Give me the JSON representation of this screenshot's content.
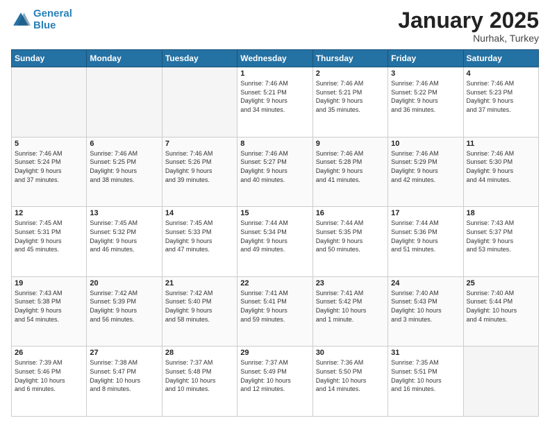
{
  "header": {
    "logo_line1": "General",
    "logo_line2": "Blue",
    "month": "January 2025",
    "location": "Nurhak, Turkey"
  },
  "weekdays": [
    "Sunday",
    "Monday",
    "Tuesday",
    "Wednesday",
    "Thursday",
    "Friday",
    "Saturday"
  ],
  "weeks": [
    [
      {
        "day": "",
        "info": ""
      },
      {
        "day": "",
        "info": ""
      },
      {
        "day": "",
        "info": ""
      },
      {
        "day": "1",
        "info": "Sunrise: 7:46 AM\nSunset: 5:21 PM\nDaylight: 9 hours\nand 34 minutes."
      },
      {
        "day": "2",
        "info": "Sunrise: 7:46 AM\nSunset: 5:21 PM\nDaylight: 9 hours\nand 35 minutes."
      },
      {
        "day": "3",
        "info": "Sunrise: 7:46 AM\nSunset: 5:22 PM\nDaylight: 9 hours\nand 36 minutes."
      },
      {
        "day": "4",
        "info": "Sunrise: 7:46 AM\nSunset: 5:23 PM\nDaylight: 9 hours\nand 37 minutes."
      }
    ],
    [
      {
        "day": "5",
        "info": "Sunrise: 7:46 AM\nSunset: 5:24 PM\nDaylight: 9 hours\nand 37 minutes."
      },
      {
        "day": "6",
        "info": "Sunrise: 7:46 AM\nSunset: 5:25 PM\nDaylight: 9 hours\nand 38 minutes."
      },
      {
        "day": "7",
        "info": "Sunrise: 7:46 AM\nSunset: 5:26 PM\nDaylight: 9 hours\nand 39 minutes."
      },
      {
        "day": "8",
        "info": "Sunrise: 7:46 AM\nSunset: 5:27 PM\nDaylight: 9 hours\nand 40 minutes."
      },
      {
        "day": "9",
        "info": "Sunrise: 7:46 AM\nSunset: 5:28 PM\nDaylight: 9 hours\nand 41 minutes."
      },
      {
        "day": "10",
        "info": "Sunrise: 7:46 AM\nSunset: 5:29 PM\nDaylight: 9 hours\nand 42 minutes."
      },
      {
        "day": "11",
        "info": "Sunrise: 7:46 AM\nSunset: 5:30 PM\nDaylight: 9 hours\nand 44 minutes."
      }
    ],
    [
      {
        "day": "12",
        "info": "Sunrise: 7:45 AM\nSunset: 5:31 PM\nDaylight: 9 hours\nand 45 minutes."
      },
      {
        "day": "13",
        "info": "Sunrise: 7:45 AM\nSunset: 5:32 PM\nDaylight: 9 hours\nand 46 minutes."
      },
      {
        "day": "14",
        "info": "Sunrise: 7:45 AM\nSunset: 5:33 PM\nDaylight: 9 hours\nand 47 minutes."
      },
      {
        "day": "15",
        "info": "Sunrise: 7:44 AM\nSunset: 5:34 PM\nDaylight: 9 hours\nand 49 minutes."
      },
      {
        "day": "16",
        "info": "Sunrise: 7:44 AM\nSunset: 5:35 PM\nDaylight: 9 hours\nand 50 minutes."
      },
      {
        "day": "17",
        "info": "Sunrise: 7:44 AM\nSunset: 5:36 PM\nDaylight: 9 hours\nand 51 minutes."
      },
      {
        "day": "18",
        "info": "Sunrise: 7:43 AM\nSunset: 5:37 PM\nDaylight: 9 hours\nand 53 minutes."
      }
    ],
    [
      {
        "day": "19",
        "info": "Sunrise: 7:43 AM\nSunset: 5:38 PM\nDaylight: 9 hours\nand 54 minutes."
      },
      {
        "day": "20",
        "info": "Sunrise: 7:42 AM\nSunset: 5:39 PM\nDaylight: 9 hours\nand 56 minutes."
      },
      {
        "day": "21",
        "info": "Sunrise: 7:42 AM\nSunset: 5:40 PM\nDaylight: 9 hours\nand 58 minutes."
      },
      {
        "day": "22",
        "info": "Sunrise: 7:41 AM\nSunset: 5:41 PM\nDaylight: 9 hours\nand 59 minutes."
      },
      {
        "day": "23",
        "info": "Sunrise: 7:41 AM\nSunset: 5:42 PM\nDaylight: 10 hours\nand 1 minute."
      },
      {
        "day": "24",
        "info": "Sunrise: 7:40 AM\nSunset: 5:43 PM\nDaylight: 10 hours\nand 3 minutes."
      },
      {
        "day": "25",
        "info": "Sunrise: 7:40 AM\nSunset: 5:44 PM\nDaylight: 10 hours\nand 4 minutes."
      }
    ],
    [
      {
        "day": "26",
        "info": "Sunrise: 7:39 AM\nSunset: 5:46 PM\nDaylight: 10 hours\nand 6 minutes."
      },
      {
        "day": "27",
        "info": "Sunrise: 7:38 AM\nSunset: 5:47 PM\nDaylight: 10 hours\nand 8 minutes."
      },
      {
        "day": "28",
        "info": "Sunrise: 7:37 AM\nSunset: 5:48 PM\nDaylight: 10 hours\nand 10 minutes."
      },
      {
        "day": "29",
        "info": "Sunrise: 7:37 AM\nSunset: 5:49 PM\nDaylight: 10 hours\nand 12 minutes."
      },
      {
        "day": "30",
        "info": "Sunrise: 7:36 AM\nSunset: 5:50 PM\nDaylight: 10 hours\nand 14 minutes."
      },
      {
        "day": "31",
        "info": "Sunrise: 7:35 AM\nSunset: 5:51 PM\nDaylight: 10 hours\nand 16 minutes."
      },
      {
        "day": "",
        "info": ""
      }
    ]
  ]
}
